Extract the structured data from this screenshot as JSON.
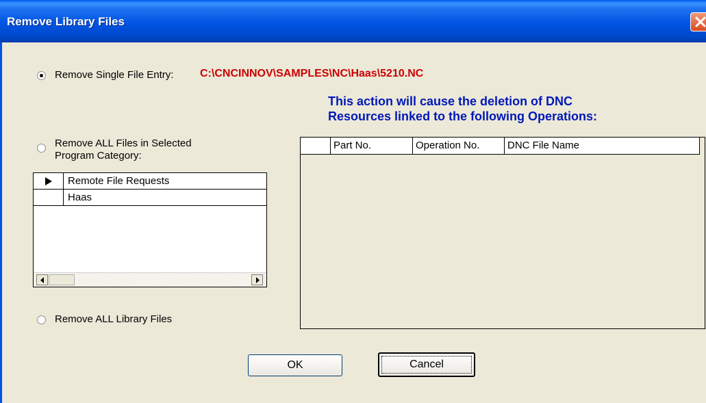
{
  "window": {
    "title": "Remove Library Files"
  },
  "options": {
    "single": {
      "label": "Remove Single File Entry:",
      "path": "C:\\CNCINNOV\\SAMPLES\\NC\\Haas\\5210.NC",
      "selected": true
    },
    "category": {
      "label_line1": "Remove ALL Files in Selected",
      "label_line2": "Program Category:",
      "selected": false
    },
    "all": {
      "label": "Remove ALL Library Files",
      "selected": false
    }
  },
  "categories": [
    {
      "name": "Remote File Requests",
      "current": true
    },
    {
      "name": "Haas",
      "current": false
    }
  ],
  "warning": {
    "line1": "This action will cause the deletion of DNC",
    "line2": "Resources linked to the following Operations:"
  },
  "operations": {
    "columns": [
      "Part No.",
      "Operation No.",
      "DNC File Name"
    ],
    "rows": []
  },
  "buttons": {
    "ok": "OK",
    "cancel": "Cancel"
  },
  "colors": {
    "path": "#cc0000",
    "warning": "#0018b8",
    "titlebar": "#0054e3",
    "dialog": "#ece9d8"
  }
}
